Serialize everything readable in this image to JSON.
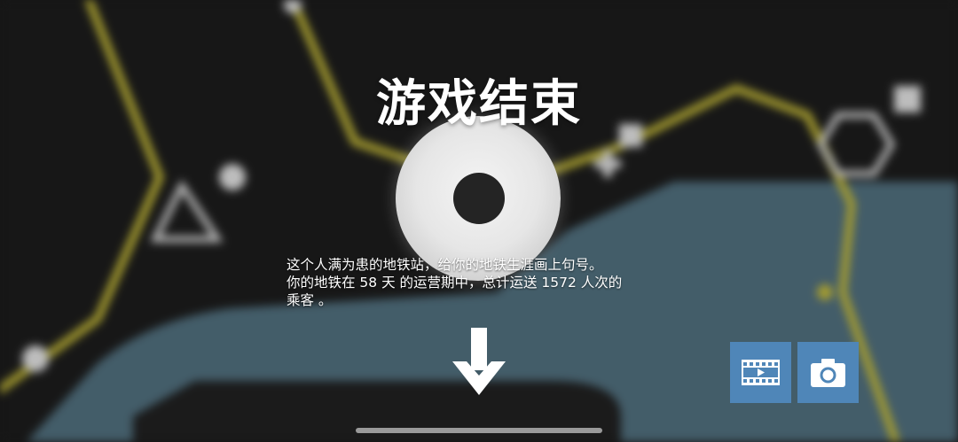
{
  "game": {
    "title": "游戏结束",
    "message_lines": [
      "这个人满为患的地铁站，给你的地铁生涯画上句号。",
      "你的地铁在 58 天 的运营期中，总计运送 1572 人次的",
      "乘客 。"
    ],
    "days": 58,
    "passengers": 1572
  },
  "controls": {
    "continue_icon": "down-arrow-icon",
    "record_video_icon": "film-icon",
    "screenshot_icon": "camera-icon"
  },
  "colors": {
    "background": "#1b1b1b",
    "metro_line": "#bdb337",
    "river": "#4d6a78",
    "button": "#4f86b8",
    "overcrowded_station": "#e8e8e8"
  }
}
